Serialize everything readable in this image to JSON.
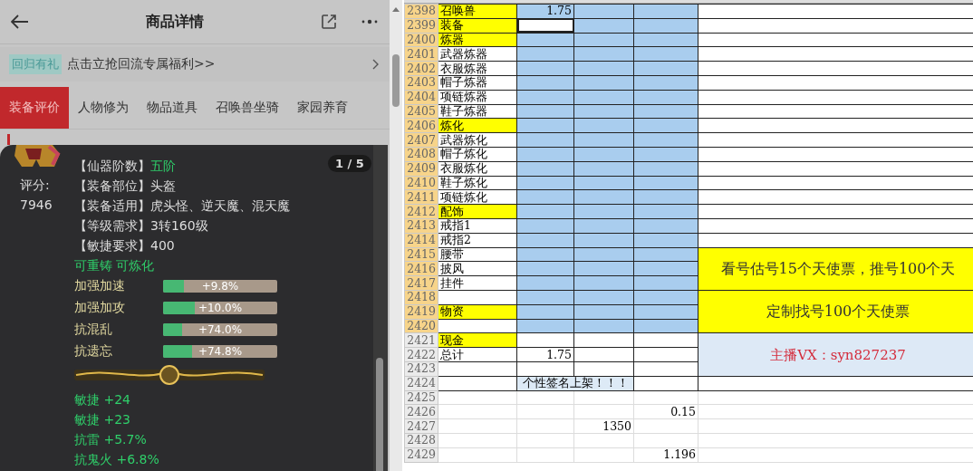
{
  "phone": {
    "title": "商品详情",
    "banner": {
      "tag": "回归有礼",
      "text": "点击立抢回流专属福利>>"
    },
    "tabs": [
      {
        "label": "装备评价",
        "selected": true
      },
      {
        "label": "人物修为",
        "selected": false
      },
      {
        "label": "物品道具",
        "selected": false
      },
      {
        "label": "召唤兽坐骑",
        "selected": false
      },
      {
        "label": "家园养育",
        "selected": false
      }
    ],
    "popup": {
      "score_label": "评分:",
      "score": "7946",
      "page": "1 / 5",
      "attributes": [
        {
          "label": "【仙器阶数】",
          "value": "五阶",
          "highlighted": true
        },
        {
          "label": "【装备部位】",
          "value": "头盔",
          "highlighted": false
        },
        {
          "label": "【装备适用】",
          "value": "虎头怪、逆天魔、混天魔",
          "highlighted": false
        },
        {
          "label": "【等级需求】",
          "value": "3转160级",
          "highlighted": false
        },
        {
          "label": "【敏捷要求】",
          "value": "400",
          "highlighted": false
        }
      ],
      "tags": "可重铸 可炼化",
      "bars": [
        {
          "label": "加强加速",
          "reading": "+9.8%",
          "level": 0.18
        },
        {
          "label": "加强加攻",
          "reading": "+10.0%",
          "level": 0.28
        },
        {
          "label": "抗混乱",
          "reading": "+74.0%",
          "level": 0.17
        },
        {
          "label": "抗遗忘",
          "reading": "+74.8%",
          "level": 0.25
        }
      ],
      "stats": [
        "敏捷 +24",
        "敏捷 +23",
        "抗雷 +5.7%",
        "抗鬼火 +6.8%"
      ]
    }
  },
  "sheet": {
    "rows": [
      {
        "number": "2398",
        "selected": true,
        "active": false,
        "highlighted": true,
        "a": "召唤兽",
        "b": "1.75",
        "kind": "plain"
      },
      {
        "number": "2399",
        "selected": true,
        "active": true,
        "highlighted": true,
        "a": "装备",
        "kind": "plain"
      },
      {
        "number": "2400",
        "selected": true,
        "active": false,
        "highlighted": true,
        "a": "炼器",
        "kind": "plain"
      },
      {
        "number": "2401",
        "selected": true,
        "active": false,
        "highlighted": false,
        "a": "武器炼器",
        "kind": "plain"
      },
      {
        "number": "2402",
        "selected": true,
        "active": false,
        "highlighted": false,
        "a": "衣服炼器",
        "kind": "plain"
      },
      {
        "number": "2403",
        "selected": true,
        "active": false,
        "highlighted": false,
        "a": "帽子炼器",
        "kind": "plain"
      },
      {
        "number": "2404",
        "selected": true,
        "active": false,
        "highlighted": false,
        "a": "项链炼器",
        "kind": "plain"
      },
      {
        "number": "2405",
        "selected": true,
        "active": false,
        "highlighted": false,
        "a": "鞋子炼器",
        "kind": "plain"
      },
      {
        "number": "2406",
        "selected": true,
        "active": false,
        "highlighted": true,
        "a": "炼化",
        "kind": "plain"
      },
      {
        "number": "2407",
        "selected": true,
        "active": false,
        "highlighted": false,
        "a": "武器炼化",
        "kind": "plain"
      },
      {
        "number": "2408",
        "selected": true,
        "active": false,
        "highlighted": false,
        "a": "帽子炼化",
        "kind": "plain"
      },
      {
        "number": "2409",
        "selected": true,
        "active": false,
        "highlighted": false,
        "a": "衣服炼化",
        "kind": "plain"
      },
      {
        "number": "2410",
        "selected": true,
        "active": false,
        "highlighted": false,
        "a": "鞋子炼化",
        "kind": "plain"
      },
      {
        "number": "2411",
        "selected": true,
        "active": false,
        "highlighted": false,
        "a": "项链炼化",
        "kind": "plain"
      },
      {
        "number": "2412",
        "selected": true,
        "active": false,
        "highlighted": true,
        "a": "配饰",
        "kind": "plain"
      },
      {
        "number": "2413",
        "selected": true,
        "active": false,
        "highlighted": false,
        "a": "戒指1",
        "kind": "plain"
      },
      {
        "number": "2414",
        "selected": true,
        "active": false,
        "highlighted": false,
        "a": "戒指2",
        "kind": "plain"
      },
      {
        "number": "2415",
        "selected": true,
        "active": false,
        "highlighted": false,
        "a": "腰带",
        "e": "看号估号15个天使票，推号100个天",
        "kind": "yellow"
      },
      {
        "number": "2416",
        "selected": true,
        "active": false,
        "highlighted": false,
        "a": "披风",
        "kind": "yellow"
      },
      {
        "number": "2417",
        "selected": true,
        "active": false,
        "highlighted": false,
        "a": "挂件",
        "kind": "yellow"
      },
      {
        "number": "2418",
        "selected": true,
        "active": false,
        "highlighted": false,
        "e": "定制找号100个天使票",
        "kind": "yellow"
      },
      {
        "number": "2419",
        "selected": true,
        "active": false,
        "highlighted": true,
        "a": "物资",
        "kind": "yellow"
      },
      {
        "number": "2420",
        "selected": true,
        "active": false,
        "highlighted": false,
        "kind": "yellow"
      },
      {
        "number": "2421",
        "selected": false,
        "active": false,
        "highlighted": true,
        "a": "现金",
        "e": "主播VX：syn827237",
        "kind": "blue"
      },
      {
        "number": "2422",
        "selected": false,
        "active": false,
        "highlighted": false,
        "a": "总计",
        "b": "1.75",
        "kind": "blue"
      },
      {
        "number": "2423",
        "selected": false,
        "active": false,
        "highlighted": false,
        "kind": "blue"
      },
      {
        "number": "2424",
        "selected": false,
        "active": false,
        "highlighted": false,
        "bc": "个性签名上架！！！",
        "kind": "plain"
      },
      {
        "number": "2425",
        "selected": false,
        "active": false,
        "highlighted": false,
        "kind": "none"
      },
      {
        "number": "2426",
        "selected": false,
        "active": false,
        "highlighted": false,
        "d": "0.15",
        "kind": "none"
      },
      {
        "number": "2427",
        "selected": false,
        "active": false,
        "highlighted": false,
        "c": "1350",
        "kind": "none"
      },
      {
        "number": "2428",
        "selected": false,
        "active": false,
        "highlighted": false,
        "kind": "none"
      },
      {
        "number": "2429",
        "selected": false,
        "active": false,
        "highlighted": false,
        "d": "1.196",
        "kind": "none"
      }
    ]
  }
}
